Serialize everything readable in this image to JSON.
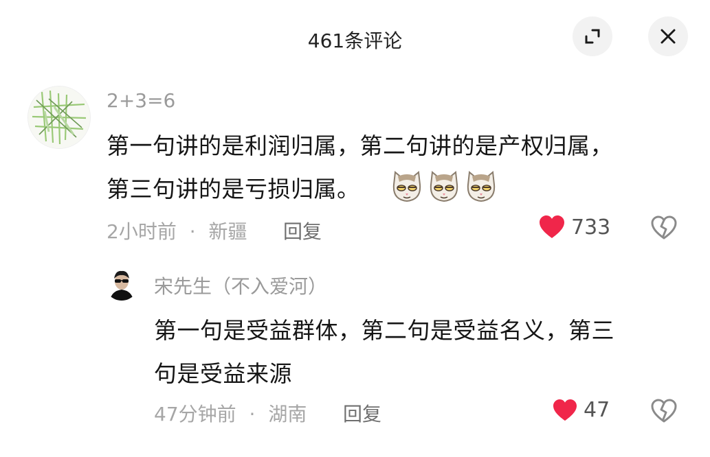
{
  "header": {
    "title": "461条评论",
    "expand_icon": "expand-icon",
    "close_icon": "close-icon"
  },
  "comment": {
    "username": "2+3=6",
    "line1": "第一句讲的是利润归属，第二句讲的是产权归属，",
    "line2": "第三句讲的是亏损归属。",
    "emojis": [
      "cat-emoji",
      "cat-emoji",
      "cat-emoji"
    ],
    "time": "2小时前",
    "separator": "·",
    "location": "新疆",
    "reply_label": "回复",
    "likes": "733"
  },
  "reply": {
    "username": "宋先生（不入爱河）",
    "line1": "第一句是受益群体，第二句是受益名义，第三",
    "line2": "句是受益来源",
    "time": "47分钟前",
    "separator": "·",
    "location": "湖南",
    "reply_label": "回复",
    "likes": "47"
  },
  "colors": {
    "like_heart": "#f0264a",
    "muted_text": "#a6a6a6",
    "main_text": "#161616"
  }
}
